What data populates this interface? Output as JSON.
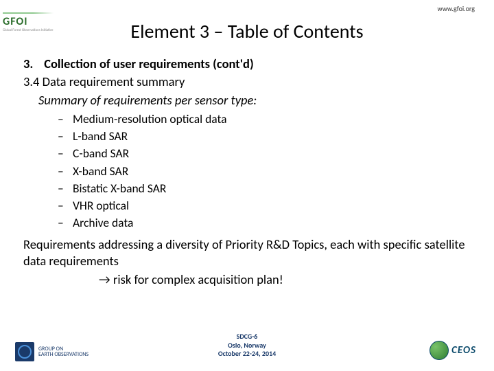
{
  "url": "www.gfoi.org",
  "topLogo": {
    "name": "GFOI",
    "subtitle": "Global Forest Observations Initiative"
  },
  "title": "Element 3 – Table of Contents",
  "section": {
    "number": "3.",
    "heading": "Collection of user requirements (cont'd)",
    "subnumber": "3.4",
    "subheading": "Data requirement summary",
    "summaryLine": "Summary of requirements per sensor type:"
  },
  "bullets": [
    "Medium-resolution optical data",
    " L-band SAR",
    "C-band SAR",
    "X-band SAR",
    "Bistatic X-band SAR",
    "VHR optical",
    "Archive data"
  ],
  "para": "Requirements addressing a diversity of Priority R&D Topics, each with specific satellite data requirements",
  "arrow": "→ risk for complex acquisition plan!",
  "footer": {
    "l1": "SDCG-6",
    "l2": "Oslo, Norway",
    "l3": "October 22-24, 2014"
  },
  "logoBL": {
    "line1": "GROUP ON",
    "line2": "EARTH OBSERVATIONS"
  },
  "logoBR": "CEOS"
}
